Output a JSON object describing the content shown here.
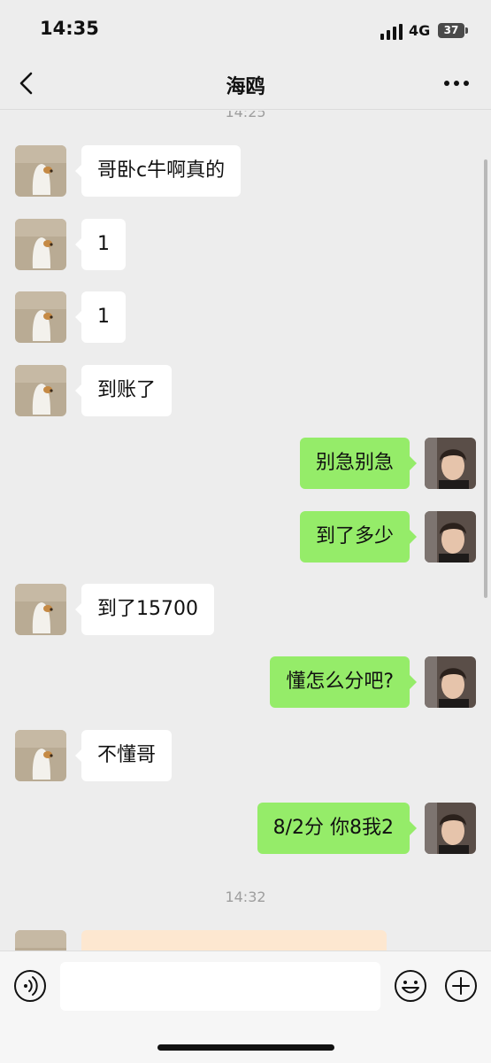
{
  "status_bar": {
    "time": "14:35",
    "network": "4G",
    "battery": "37"
  },
  "header": {
    "title": "海鸥"
  },
  "messages": {
    "ts1": "14:25",
    "m1": "哥卧c牛啊真的",
    "m2": "1",
    "m3": "1",
    "m4": "到账了",
    "m5": "别急别急",
    "m6": "到了多少",
    "m7": "到了15700",
    "m8": "懂怎么分吧?",
    "m9": "不懂哥",
    "m10": "8/2分 你8我2",
    "ts2": "14:32"
  },
  "colors": {
    "outgoing": "#95ec69",
    "incoming": "#ffffff",
    "background": "#ededed"
  },
  "icons": [
    "back-icon",
    "more-icon",
    "voice-icon",
    "emoji-icon",
    "plus-icon"
  ]
}
